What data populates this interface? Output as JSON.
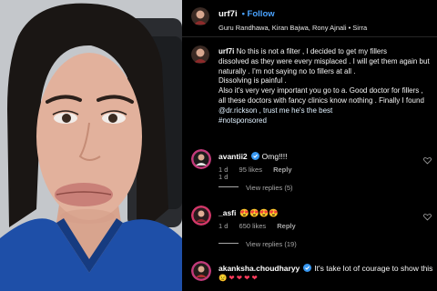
{
  "post": {
    "header": {
      "username": "urf7i",
      "follow_label": "Follow",
      "meta_line": "Guru Randhawa, Kiran Bajwa, Rony Ajnali • Sirra"
    },
    "caption": {
      "username": "urf7i",
      "lines": [
        "No this is not a filter , I decided to get my fillers",
        "dissolved as they were every misplaced . I will get them again but",
        "naturally . I'm not saying no to fillers at all .",
        "Dissolving is painful .",
        "Also it's very very important you go to a. Good doctor for fillers ,",
        "all these doctors with fancy clinics know nothing . Finally I found",
        "@dr.rickson , trust me he's the best",
        "#notsponsored"
      ],
      "time": "1 d"
    },
    "comments": [
      {
        "username": "avantii2",
        "text": "Omg!!!!",
        "time": "1 d",
        "likes": "95 likes",
        "reply_label": "Reply",
        "view_replies": "View replies (5)"
      },
      {
        "username": "_asfi",
        "text": "ðŸ˜‡ðŸ˜‡ðŸ˜‡ðŸ˜‡",
        "text_display": "😍😍😍😍",
        "time": "1 d",
        "likes": "650 likes",
        "reply_label": "Reply",
        "view_replies": "View replies (19)"
      },
      {
        "username": "akanksha.choudharyy",
        "text": "It's take lot of courage to show this",
        "emoji_line": "😟 ❤ ❤ ❤ ❤"
      }
    ]
  },
  "colors": {
    "follow": "#4aa3ff",
    "verified": "#3797f0",
    "link": "#e0f1ff",
    "muted": "#a8a8a8"
  }
}
